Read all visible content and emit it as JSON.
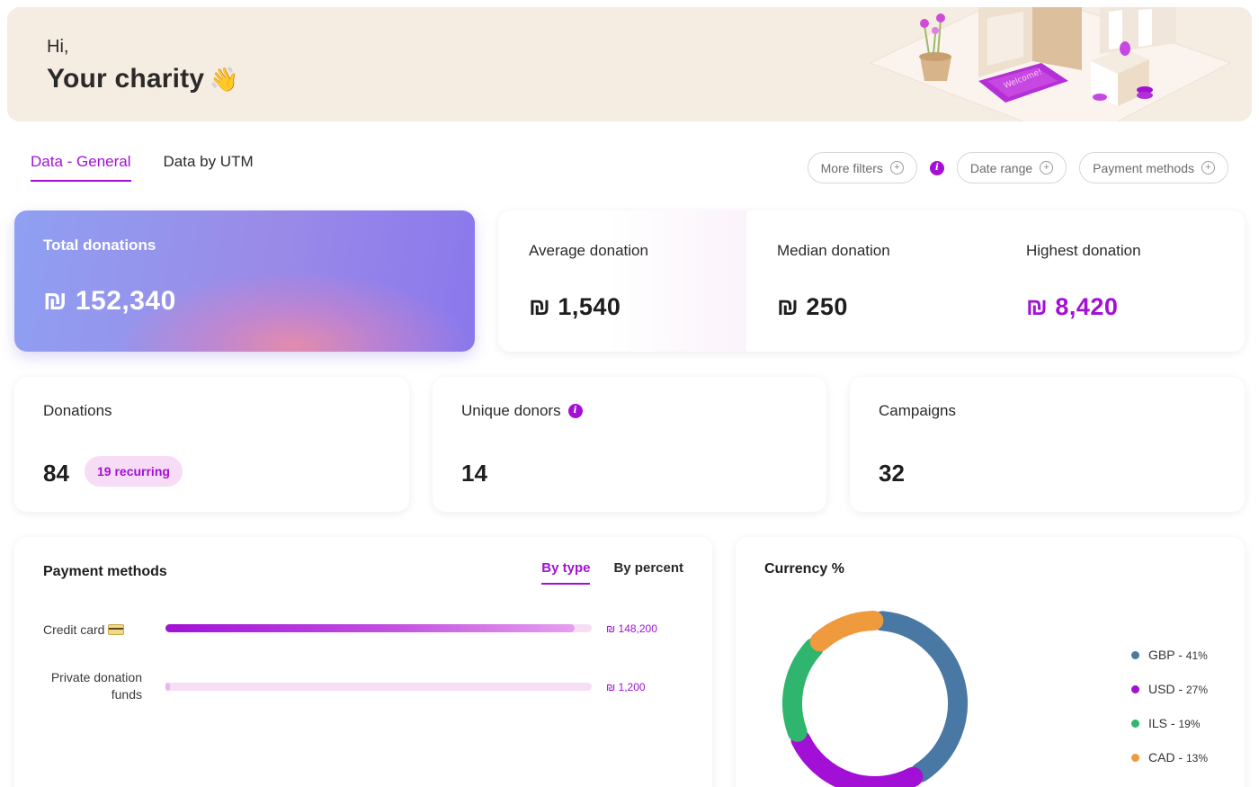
{
  "header": {
    "greeting": "Hi,",
    "title": "Your charity",
    "wave_emoji": "👋"
  },
  "tabs": [
    {
      "label": "Data - General",
      "active": true
    },
    {
      "label": "Data by UTM",
      "active": false
    }
  ],
  "filters": {
    "more_filters": "More filters",
    "date_range": "Date range",
    "payment_methods": "Payment methods",
    "plus_glyph": "+",
    "info_glyph": "i"
  },
  "total": {
    "label": "Total donations",
    "value": "₪ 152,340"
  },
  "stats": [
    {
      "label": "Average donation",
      "value": "₪ 1,540"
    },
    {
      "label": "Median donation",
      "value": "₪ 250"
    },
    {
      "label": "Highest donation",
      "value": "₪ 8,420"
    }
  ],
  "donations": {
    "label": "Donations",
    "value": "84",
    "recurring": "19 recurring"
  },
  "unique_donors": {
    "label": "Unique donors",
    "value": "14"
  },
  "campaigns": {
    "label": "Campaigns",
    "value": "32"
  },
  "payment_methods": {
    "title": "Payment methods",
    "tabs": [
      {
        "label": "By type",
        "active": true
      },
      {
        "label": "By percent",
        "active": false
      }
    ],
    "rows": [
      {
        "label": "Credit card",
        "value": "₪ 148,200",
        "fraction": 0.96
      },
      {
        "label": "Private donation funds",
        "label_line1": "Private donation",
        "label_line2": "funds",
        "value": "₪ 1,200",
        "fraction": 0.01
      }
    ]
  },
  "currency": {
    "title": "Currency %",
    "slices": [
      {
        "label": "GBP - ",
        "pct": "41%",
        "value": 41,
        "color": "#4a78a4"
      },
      {
        "label": "USD - ",
        "pct": "27%",
        "value": 27,
        "color": "#a210d6"
      },
      {
        "label": "ILS - ",
        "pct": "19%",
        "value": 19,
        "color": "#2fb56e"
      },
      {
        "label": "CAD - ",
        "pct": "13%",
        "value": 13,
        "color": "#ef9a3d"
      }
    ]
  },
  "colors": {
    "accent": "#a210d6",
    "banner_bg": "#f5ece2"
  }
}
